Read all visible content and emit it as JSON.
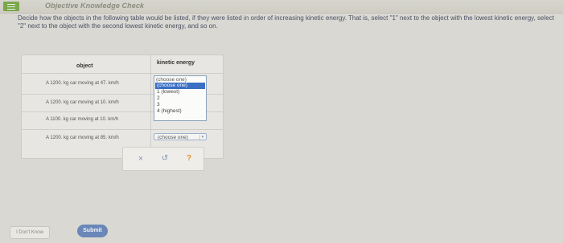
{
  "header": {
    "title": "Objective Knowledge Check"
  },
  "question": {
    "text": "Decide how the objects in the following table would be listed, if they were listed in order of increasing kinetic energy. That is, select \"1\" next to the object with the lowest kinetic energy, select \"2\" next to the object with the second lowest kinetic energy, and so on."
  },
  "table": {
    "headers": {
      "object": "object",
      "kinetic_energy": "kinetic energy"
    },
    "rows": [
      {
        "object": "A 1200. kg car moving at 47. km/h",
        "selection": "(choose one)"
      },
      {
        "object": "A 1200. kg car moving at 10. km/h",
        "selection": ""
      },
      {
        "object": "A 1100. kg car moving at 10. km/h",
        "selection": ""
      },
      {
        "object": "A 1200. kg car moving at 85. km/h",
        "selection": "(choose one)"
      }
    ],
    "dropdown": {
      "options": [
        "(choose one)",
        "(choose one)",
        "1 (lowest)",
        "2",
        "3",
        "4 (highest)"
      ],
      "highlighted_index": 1
    }
  },
  "toolbar": {
    "clear_symbol": "×",
    "undo_symbol": "↺",
    "help_symbol": "?"
  },
  "buttons": {
    "dont_know": "I Don't Know",
    "submit": "Submit"
  },
  "colors": {
    "accent": "#6a87b8",
    "menu": "#7aa84d",
    "help": "#e0942b"
  }
}
